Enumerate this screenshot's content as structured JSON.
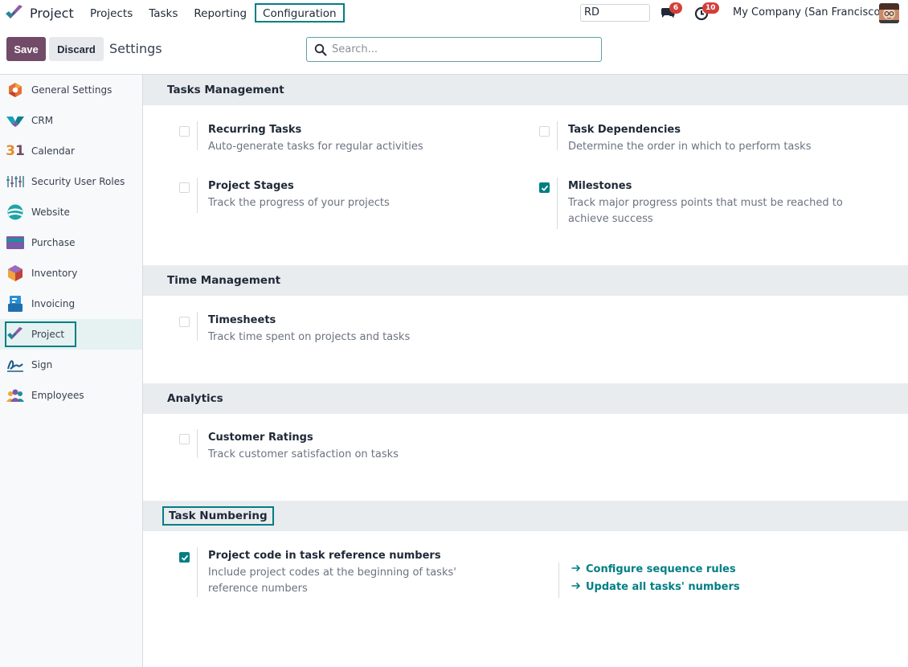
{
  "navbar": {
    "app_name": "Project",
    "menu": [
      "Projects",
      "Tasks",
      "Reporting",
      "Configuration"
    ],
    "focused_menu": "Configuration",
    "company_input": "RD",
    "messages_badge": "6",
    "activities_badge": "10",
    "company_name": "My Company (San Francisco)"
  },
  "control": {
    "save_label": "Save",
    "discard_label": "Discard",
    "title": "Settings",
    "search_placeholder": "Search..."
  },
  "sidebar": {
    "items": [
      {
        "label": "General Settings",
        "icon": "general-settings-icon"
      },
      {
        "label": "CRM",
        "icon": "crm-icon"
      },
      {
        "label": "Calendar",
        "icon": "calendar-icon"
      },
      {
        "label": "Security User Roles",
        "icon": "security-roles-icon"
      },
      {
        "label": "Website",
        "icon": "website-icon"
      },
      {
        "label": "Purchase",
        "icon": "purchase-icon"
      },
      {
        "label": "Inventory",
        "icon": "inventory-icon"
      },
      {
        "label": "Invoicing",
        "icon": "invoicing-icon"
      },
      {
        "label": "Project",
        "icon": "project-icon"
      },
      {
        "label": "Sign",
        "icon": "sign-icon"
      },
      {
        "label": "Employees",
        "icon": "employees-icon"
      }
    ],
    "active": "Project",
    "calendar_glyph": "31"
  },
  "sections": {
    "tasks_management": {
      "title": "Tasks Management",
      "recurring_tasks": {
        "title": "Recurring Tasks",
        "desc": "Auto-generate tasks for regular activities",
        "checked": false
      },
      "task_dependencies": {
        "title": "Task Dependencies",
        "desc": "Determine the order in which to perform tasks",
        "checked": false
      },
      "project_stages": {
        "title": "Project Stages",
        "desc": "Track the progress of your projects",
        "checked": false
      },
      "milestones": {
        "title": "Milestones",
        "desc": "Track major progress points that must be reached to achieve success",
        "checked": true
      }
    },
    "time_management": {
      "title": "Time Management",
      "timesheets": {
        "title": "Timesheets",
        "desc": "Track time spent on projects and tasks",
        "checked": false
      }
    },
    "analytics": {
      "title": "Analytics",
      "customer_ratings": {
        "title": "Customer Ratings",
        "desc": "Track customer satisfaction on tasks",
        "checked": false
      }
    },
    "task_numbering": {
      "title": "Task Numbering",
      "project_code": {
        "title": "Project code in task reference numbers",
        "desc": "Include project codes at the beginning of tasks' reference numbers",
        "checked": true
      },
      "link_configure": "Configure sequence rules",
      "link_update": "Update all tasks' numbers"
    }
  },
  "colors": {
    "accent": "#017e84",
    "primary": "#714b67",
    "badge": "#d23f3a",
    "section_bg": "#e9ecef"
  }
}
